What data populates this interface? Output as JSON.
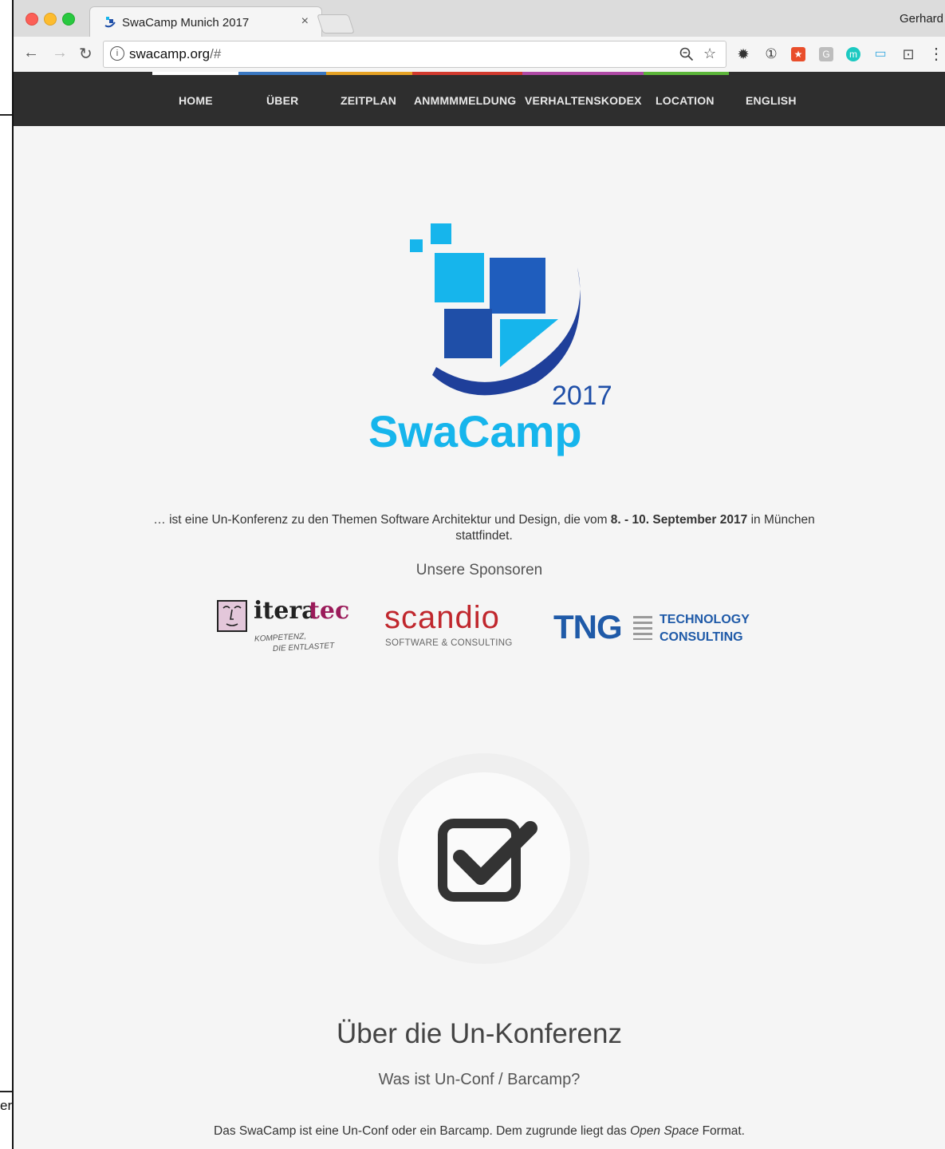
{
  "outside": {
    "fragment": "er"
  },
  "browser": {
    "tab_title": "SwaCamp Munich 2017",
    "tab_close": "×",
    "profile_name": "Gerhard",
    "url_host": "swacamp.org",
    "url_rest": "/#",
    "info_glyph": "i",
    "extensions": [
      {
        "name": "gear-extension-icon",
        "glyph": "✹"
      },
      {
        "name": "onepassword-extension-icon",
        "glyph": "①"
      },
      {
        "name": "star-badge-extension-icon",
        "glyph": "★"
      },
      {
        "name": "g-extension-icon",
        "glyph": "G"
      },
      {
        "name": "m-extension-icon",
        "glyph": "m"
      },
      {
        "name": "tv-extension-icon",
        "glyph": "▭"
      },
      {
        "name": "cast-icon",
        "glyph": "⊡"
      },
      {
        "name": "menu-icon",
        "glyph": "⋮"
      }
    ]
  },
  "nav": {
    "items": [
      "HOME",
      "ÜBER",
      "ZEITPLAN",
      "ANMMMMELDUNG",
      "VERHALTENSKODEX",
      "LOCATION",
      "ENGLISH"
    ],
    "bar_colors": [
      "#ffffff",
      "#3a78c2",
      "#e6a224",
      "#d23a2e",
      "#b04aa6",
      "#5cb63a"
    ]
  },
  "hero": {
    "logo_year": "2017",
    "logo_name": "SwaCamp",
    "intro_before": "… ist eine Un-Konferenz zu den Themen Software Architektur und Design, die vom ",
    "intro_bold": "8. - 10. September 2017",
    "intro_after": " in München stattfindet."
  },
  "sponsors": {
    "heading": "Unsere Sponsoren",
    "iteratec": {
      "name_a": "itera",
      "name_b": "tec",
      "tagline_1": "KOMPETENZ,",
      "tagline_2": "DIE ENTLASTET"
    },
    "scandio": {
      "name": "scandio",
      "tagline": "SOFTWARE & CONSULTING"
    },
    "tng": {
      "name": "TNG",
      "line_1": "TECHNOLOGY",
      "line_2": "CONSULTING"
    }
  },
  "about": {
    "title": "Über die Un-Konferenz",
    "subtitle": "Was ist Un-Conf / Barcamp?",
    "p_before": "Das SwaCamp ist eine Un-Conf oder ein Barcamp. Dem zugrunde liegt das ",
    "p_em": "Open Space",
    "p_after": " Format."
  },
  "colors": {
    "logo_cyan": "#16b5ec",
    "logo_blue": "#1f4fa8",
    "nav_bg": "#2e2e2e",
    "iteratec_tec": "#9b1b5a",
    "scandio_red": "#c0272d",
    "tng_blue": "#1f5aa8"
  }
}
